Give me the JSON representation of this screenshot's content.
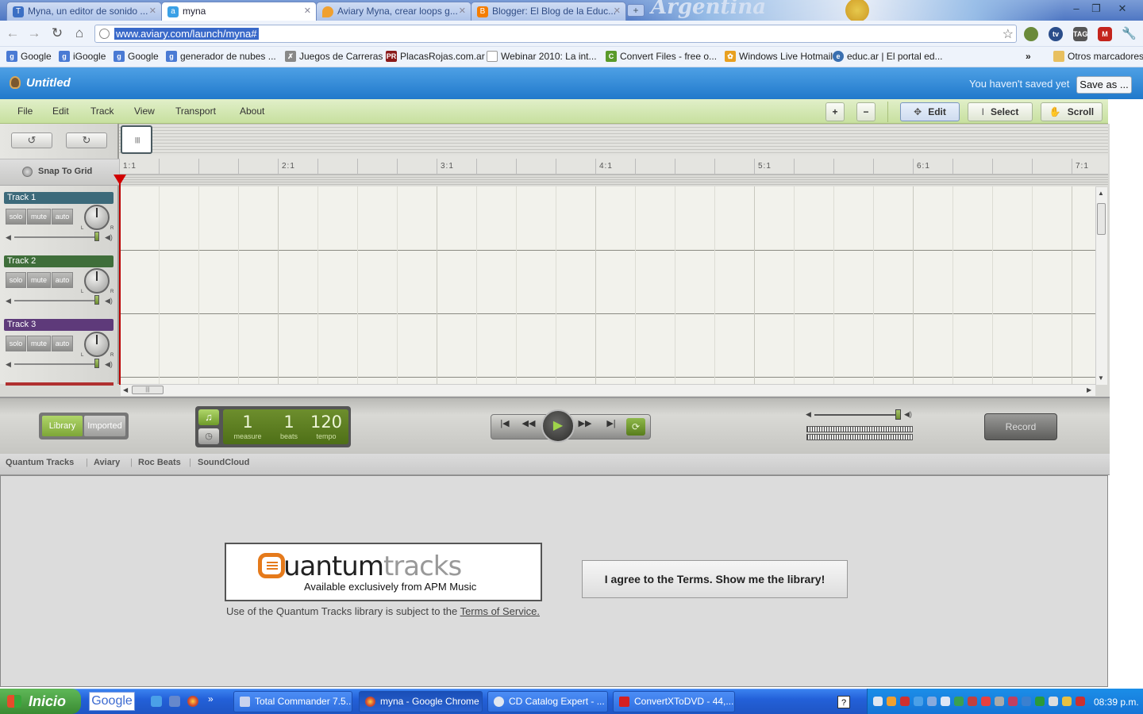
{
  "browser": {
    "tabs": [
      {
        "label": "Myna, un editor de sonido ...",
        "icon": "T"
      },
      {
        "label": "myna",
        "icon": "a"
      },
      {
        "label": "Aviary Myna, crear loops g...",
        "icon": "drop"
      },
      {
        "label": "Blogger: El Blog de la Educ...",
        "icon": "B"
      }
    ],
    "banner_text": "Argentina",
    "url": "www.aviary.com/launch/myna#",
    "bookmarks": [
      "Google",
      "iGoogle",
      "Google",
      "generador de nubes ...",
      "Juegos de Carreras",
      "PlacasRojas.com.ar",
      "Webinar 2010: La int...",
      "Convert Files - free o...",
      "Windows Live Hotmail",
      "educ.ar | El portal ed..."
    ],
    "other_bookmarks": "Otros marcadores"
  },
  "app": {
    "title": "Untitled",
    "unsaved_notice": "You haven't saved yet",
    "save_as": "Save as ...",
    "menus": [
      "File",
      "Edit",
      "Track",
      "View",
      "Transport",
      "About"
    ],
    "tools": {
      "edit": "Edit",
      "select": "Select",
      "scroll": "Scroll"
    },
    "snap_to_grid": "Snap To Grid",
    "ruler_labels": [
      "1:1",
      "2:1",
      "3:1",
      "4:1",
      "5:1",
      "6:1",
      "7:1"
    ],
    "tracks": [
      {
        "name": "Track 1",
        "color": "#3c6a7a"
      },
      {
        "name": "Track 2",
        "color": "#3f6e3a"
      },
      {
        "name": "Track 3",
        "color": "#5e3a7a"
      }
    ],
    "track_buttons": {
      "solo": "solo",
      "mute": "mute",
      "auto": "auto"
    },
    "knob_l": "L",
    "knob_r": "R"
  },
  "transport": {
    "library": "Library",
    "imported": "Imported",
    "measure": "1",
    "measure_label": "measure",
    "beats": "1",
    "beats_label": "beats",
    "tempo": "120",
    "tempo_label": "tempo",
    "record": "Record"
  },
  "library": {
    "tabs": [
      "Quantum Tracks",
      "Aviary",
      "Roc Beats",
      "SoundCloud"
    ],
    "logo_main": "uantum",
    "logo_light": "tracks",
    "logo_sub": "Available exclusively from APM Music",
    "terms_prefix": "Use of the Quantum Tracks library is subject to the ",
    "terms_link": "Terms of Service.",
    "agree_button": "I agree to the Terms. Show me the library!"
  },
  "taskbar": {
    "start": "Inicio",
    "search": "Google",
    "tasks": [
      "Total Commander 7.5...",
      "myna - Google Chrome",
      "CD Catalog Expert - ...",
      "ConvertXToDVD - 44,..."
    ],
    "clock": "08:39 p.m."
  }
}
